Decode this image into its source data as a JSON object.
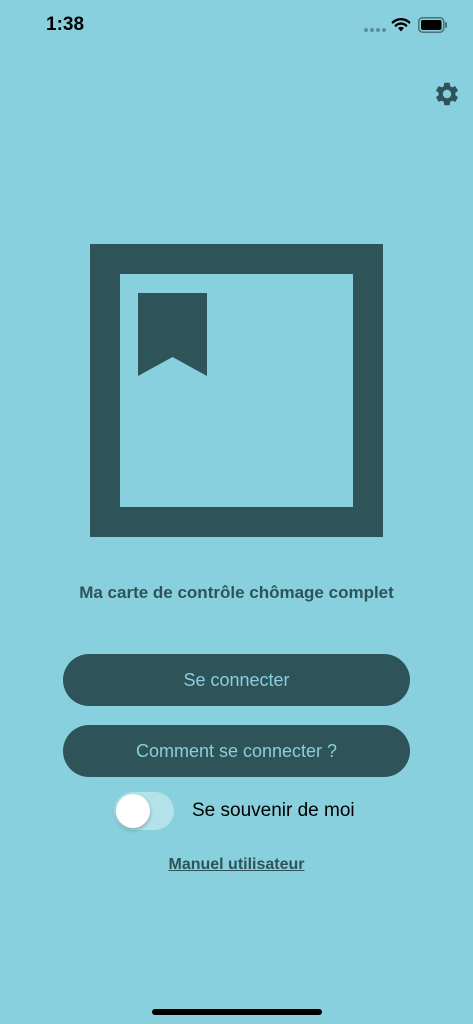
{
  "status_bar": {
    "time": "1:38",
    "icons": [
      "cellular-signal-icon",
      "wifi-icon",
      "battery-icon"
    ]
  },
  "header": {
    "settings_icon": "gear-icon"
  },
  "logo": {
    "icon": "bookmark-card-icon"
  },
  "main": {
    "title": "Ma carte de contrôle chômage complet",
    "login_button": "Se connecter",
    "howto_button": "Comment se connecter ?",
    "remember_me": {
      "label": "Se souvenir de moi",
      "enabled": false
    },
    "manual_link": "Manuel utilisateur"
  },
  "colors": {
    "background": "#88d0dd",
    "primary": "#2e5459",
    "button_text": "#88d0dd"
  }
}
